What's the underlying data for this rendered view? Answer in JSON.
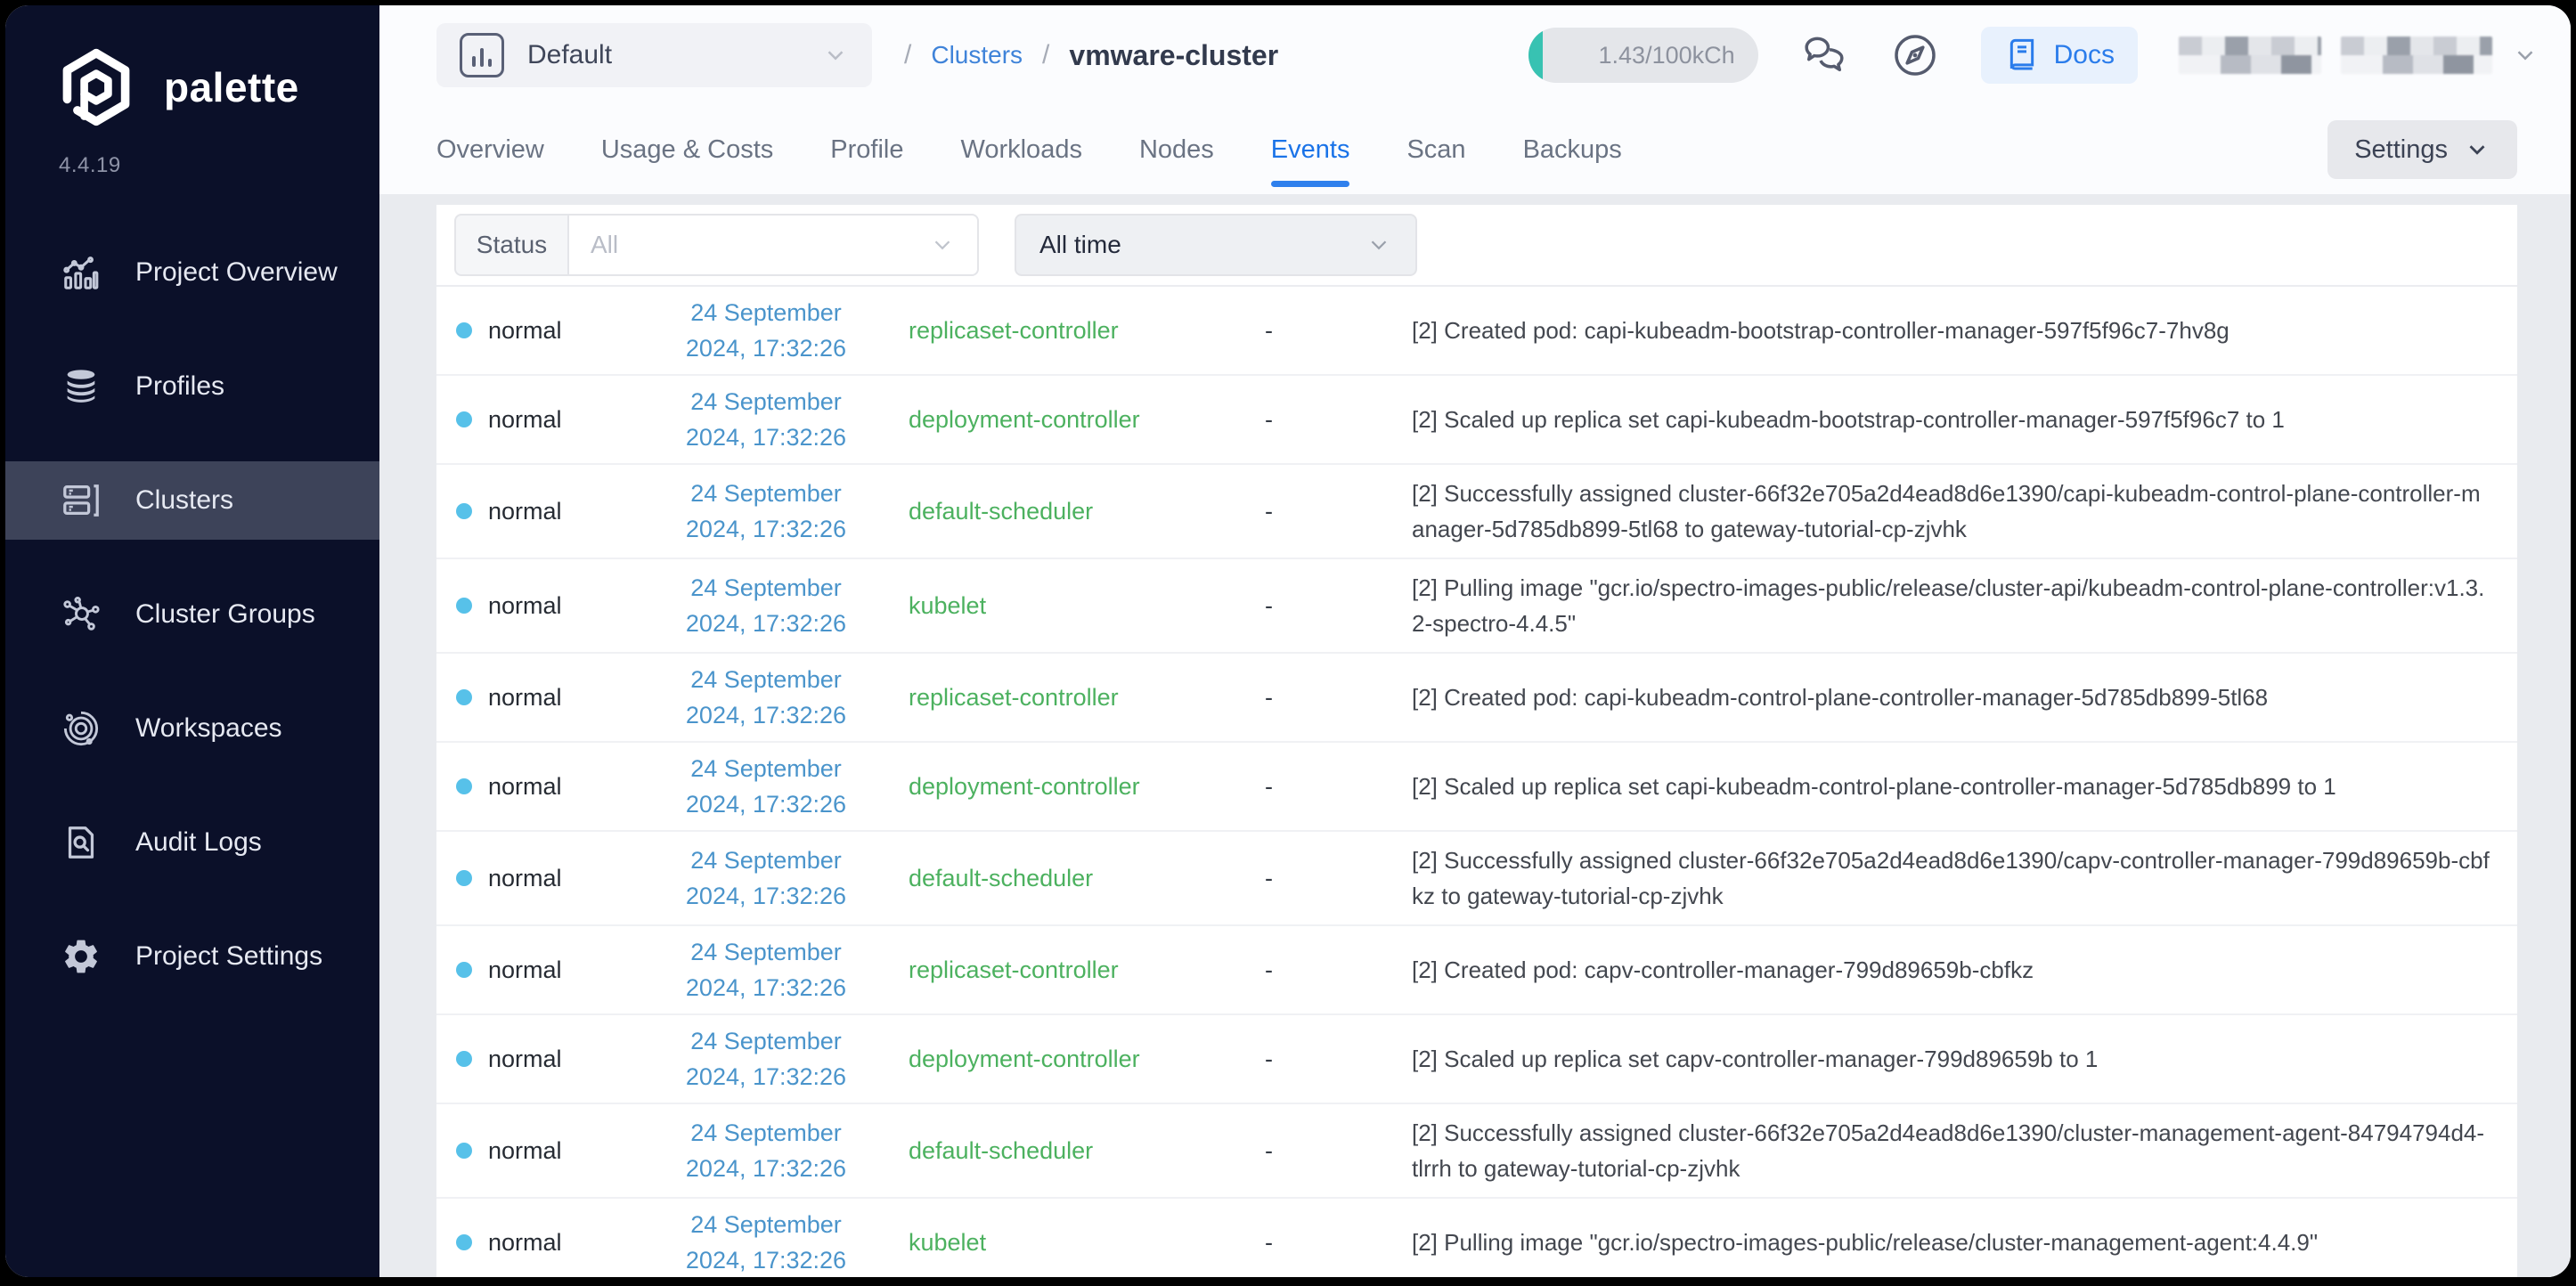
{
  "app": {
    "logo_text": "palette",
    "version": "4.4.19"
  },
  "sidebar": {
    "items": [
      {
        "label": "Project Overview",
        "icon": "bar-chart-icon",
        "active": false
      },
      {
        "label": "Profiles",
        "icon": "layers-icon",
        "active": false
      },
      {
        "label": "Clusters",
        "icon": "server-stack-icon",
        "active": true
      },
      {
        "label": "Cluster Groups",
        "icon": "node-graph-icon",
        "active": false
      },
      {
        "label": "Workspaces",
        "icon": "orbit-icon",
        "active": false
      },
      {
        "label": "Audit Logs",
        "icon": "document-search-icon",
        "active": false
      },
      {
        "label": "Project Settings",
        "icon": "gear-icon",
        "active": false
      }
    ]
  },
  "header": {
    "project_selector": "Default",
    "breadcrumb": {
      "slash": "/",
      "section": "Clusters",
      "current": "vmware-cluster"
    },
    "usage_badge": "1.43/100kCh",
    "docs_label": "Docs"
  },
  "tabs": {
    "items": [
      "Overview",
      "Usage & Costs",
      "Profile",
      "Workloads",
      "Nodes",
      "Events",
      "Scan",
      "Backups"
    ],
    "active": "Events",
    "settings_label": "Settings"
  },
  "filters": {
    "status_label": "Status",
    "status_value": "All",
    "time_value": "All time"
  },
  "events": {
    "rows": [
      {
        "status": "normal",
        "date_line1": "24 September",
        "date_line2": "2024, 17:32:26",
        "source": "replicaset-controller",
        "dash": "-",
        "message": "[2] Created pod: capi-kubeadm-bootstrap-controller-manager-597f5f96c7-7hv8g"
      },
      {
        "status": "normal",
        "date_line1": "24 September",
        "date_line2": "2024, 17:32:26",
        "source": "deployment-controller",
        "dash": "-",
        "message": "[2] Scaled up replica set capi-kubeadm-bootstrap-controller-manager-597f5f96c7 to 1"
      },
      {
        "status": "normal",
        "date_line1": "24 September",
        "date_line2": "2024, 17:32:26",
        "source": "default-scheduler",
        "dash": "-",
        "message": "[2] Successfully assigned cluster-66f32e705a2d4ead8d6e1390/capi-kubeadm-control-plane-controller-manager-5d785db899-5tl68 to gateway-tutorial-cp-zjvhk"
      },
      {
        "status": "normal",
        "date_line1": "24 September",
        "date_line2": "2024, 17:32:26",
        "source": "kubelet",
        "dash": "-",
        "message": "[2] Pulling image \"gcr.io/spectro-images-public/release/cluster-api/kubeadm-control-plane-controller:v1.3.2-spectro-4.4.5\""
      },
      {
        "status": "normal",
        "date_line1": "24 September",
        "date_line2": "2024, 17:32:26",
        "source": "replicaset-controller",
        "dash": "-",
        "message": "[2] Created pod: capi-kubeadm-control-plane-controller-manager-5d785db899-5tl68"
      },
      {
        "status": "normal",
        "date_line1": "24 September",
        "date_line2": "2024, 17:32:26",
        "source": "deployment-controller",
        "dash": "-",
        "message": "[2] Scaled up replica set capi-kubeadm-control-plane-controller-manager-5d785db899 to 1"
      },
      {
        "status": "normal",
        "date_line1": "24 September",
        "date_line2": "2024, 17:32:26",
        "source": "default-scheduler",
        "dash": "-",
        "message": "[2] Successfully assigned cluster-66f32e705a2d4ead8d6e1390/capv-controller-manager-799d89659b-cbfkz to gateway-tutorial-cp-zjvhk"
      },
      {
        "status": "normal",
        "date_line1": "24 September",
        "date_line2": "2024, 17:32:26",
        "source": "replicaset-controller",
        "dash": "-",
        "message": "[2] Created pod: capv-controller-manager-799d89659b-cbfkz"
      },
      {
        "status": "normal",
        "date_line1": "24 September",
        "date_line2": "2024, 17:32:26",
        "source": "deployment-controller",
        "dash": "-",
        "message": "[2] Scaled up replica set capv-controller-manager-799d89659b to 1"
      },
      {
        "status": "normal",
        "date_line1": "24 September",
        "date_line2": "2024, 17:32:26",
        "source": "default-scheduler",
        "dash": "-",
        "message": "[2] Successfully assigned cluster-66f32e705a2d4ead8d6e1390/cluster-management-agent-84794794d4-tlrrh to gateway-tutorial-cp-zjvhk"
      },
      {
        "status": "normal",
        "date_line1": "24 September",
        "date_line2": "2024, 17:32:26",
        "source": "kubelet",
        "dash": "-",
        "message": "[2] Pulling image \"gcr.io/spectro-images-public/release/cluster-management-agent:4.4.9\""
      }
    ]
  },
  "colors": {
    "accent_blue": "#1a73e8",
    "breadcrumb_link": "#3f83d9",
    "date_blue": "#4a94cb",
    "source_green": "#4cb15f",
    "status_dot": "#57c1e9",
    "usage_teal": "#38c2b2",
    "sidebar_bg": "#0b1029",
    "active_item_bg": "#3d4359"
  }
}
